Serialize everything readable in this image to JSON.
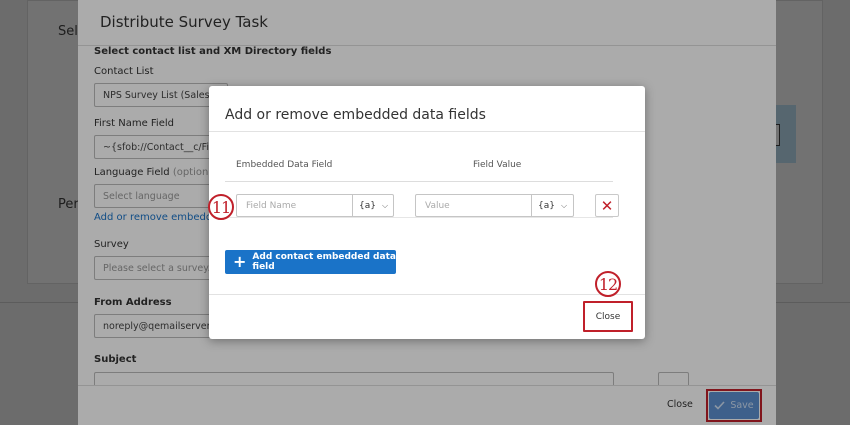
{
  "background": {
    "label_select": "Sel",
    "label_per": "Per"
  },
  "panel": {
    "title": "Distribute Survey Task",
    "section_heading": "Select contact list and XM Directory fields",
    "contact_list_label": "Contact List",
    "contact_list_value": "NPS Survey List (Sales...",
    "first_name_label": "First Name Field",
    "first_name_value": "~{sfob://Contact__c/FirstN",
    "language_label": "Language Field",
    "language_optional": "(optional)",
    "language_placeholder": "Select language",
    "embedded_link": "Add or remove embedded d",
    "survey_label": "Survey",
    "survey_placeholder": "Please select a survey...",
    "from_label": "From Address",
    "from_value": "noreply@qemailserver.co",
    "subject_label": "Subject",
    "footer_close": "Close",
    "footer_save": "Save"
  },
  "modal": {
    "title": "Add or remove embedded data fields",
    "col_field": "Embedded Data Field",
    "col_value": "Field Value",
    "field_name_placeholder": "Field Name",
    "field_value_placeholder": "Value",
    "piped_text": "{a}",
    "add_button": "Add contact embedded data field",
    "close_button": "Close"
  },
  "badges": {
    "step_11": "11",
    "step_12": "12"
  },
  "colors": {
    "accent_blue": "#1a73c8",
    "highlight_red": "#c0202a"
  }
}
